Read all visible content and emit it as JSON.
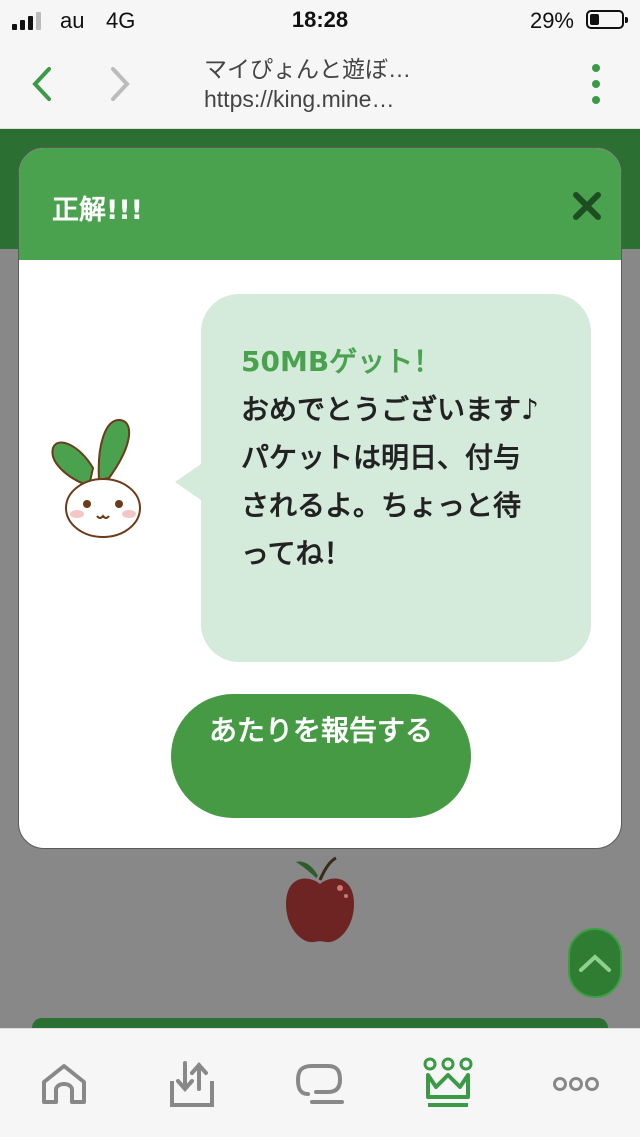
{
  "status_bar": {
    "carrier": "au",
    "network": "4G",
    "time": "18:28",
    "battery_percent": "29%",
    "battery_level": 0.29
  },
  "browser": {
    "page_title": "マイぴょんと遊ぼ…",
    "url": "https://king.mine…"
  },
  "modal": {
    "title": "正解!!!",
    "reward_text": "50MBゲット！",
    "message": "おめでとうございます♪\nパケットは明日、付与されるよ。ちょっと待ってね！",
    "report_button": "あたりを報告する"
  },
  "colors": {
    "accent": "#4aa24e",
    "dark_green": "#2b6f33",
    "bubble": "#d4ebdc",
    "overlay": "#888888"
  },
  "tab_bar": {
    "items": [
      {
        "icon": "home-icon"
      },
      {
        "icon": "download-icon"
      },
      {
        "icon": "chat-icon"
      },
      {
        "icon": "crown-icon",
        "active": true
      },
      {
        "icon": "more-icon"
      }
    ]
  }
}
